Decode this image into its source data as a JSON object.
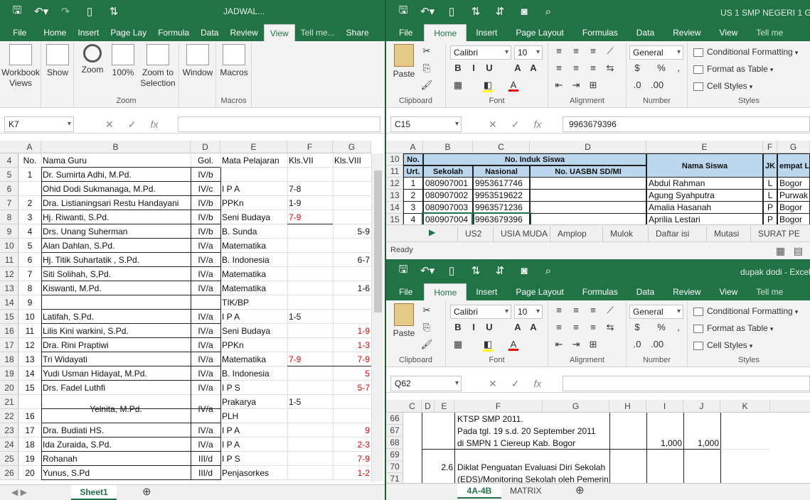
{
  "left": {
    "title": "JADWAL...",
    "tabs": [
      "File",
      "Home",
      "Insert",
      "Page Lay",
      "Formula",
      "Data",
      "Review",
      "View",
      "Tell me...",
      "Share"
    ],
    "active_tab": "View",
    "ribbon": {
      "workbook_views": "Workbook Views",
      "show": "Show",
      "zoom": "Zoom",
      "zoom100": "100%",
      "zoom_sel": "Zoom to Selection",
      "zoom_group": "Zoom",
      "window": "Window",
      "macros": "Macros",
      "macros_group": "Macros"
    },
    "namebox": "K7",
    "formula": "",
    "columns": [
      "A",
      "B",
      "D",
      "E",
      "F",
      "G"
    ],
    "rows": [
      {
        "r": "4",
        "a": "No.",
        "b": "Nama Guru",
        "d": "Gol.",
        "e": "Mata Pelajaran",
        "f": "Kls.VII",
        "g": "Kls.VIII"
      },
      {
        "r": "5",
        "a": "1",
        "b": "Dr. Sumirta Adhi, M.Pd.",
        "d": "IV/b",
        "e": "",
        "f": "",
        "g": ""
      },
      {
        "r": "6",
        "a": "",
        "b": "Ohid Dodi Sukmanaga, M.Pd.",
        "d": "IV/c",
        "e": "I P A",
        "f": "7-8",
        "g": ""
      },
      {
        "r": "7",
        "a": "2",
        "b": "Dra. Listianingsari Restu Handayani",
        "d": "IV/b",
        "e": "PPKn",
        "f": "1-9",
        "g": ""
      },
      {
        "r": "8",
        "a": "3",
        "b": "Hj. Riwanti, S.Pd.",
        "d": "IV/b",
        "e": "Seni Budaya",
        "f": "7-9",
        "g": ""
      },
      {
        "r": "9",
        "a": "4",
        "b": "Drs. Unang Suherman",
        "d": "IV/b",
        "e": "B. Sunda",
        "f": "",
        "g": "5-9"
      },
      {
        "r": "10",
        "a": "5",
        "b": "Alan Dahlan, S.Pd.",
        "d": "IV/a",
        "e": "Matematika",
        "f": "",
        "g": ""
      },
      {
        "r": "11",
        "a": "6",
        "b": "Hj. Titik Suhartatik , S.Pd.",
        "d": "IV/a",
        "e": "B. Indonesia",
        "f": "",
        "g": "6-7"
      },
      {
        "r": "12",
        "a": "7",
        "b": "Siti Solihah, S,Pd.",
        "d": "IV/a",
        "e": "Matematika",
        "f": "",
        "g": ""
      },
      {
        "r": "13",
        "a": "8",
        "b": "Kiswanti, M.Pd.",
        "d": "IV/a",
        "e": "Matematika",
        "f": "",
        "g": "1-6"
      },
      {
        "r": "14",
        "a": "9",
        "b": "",
        "d": "",
        "e": "TIK/BP",
        "f": "",
        "g": ""
      },
      {
        "r": "15",
        "a": "10",
        "b": "Latifah, S.Pd.",
        "d": "IV/a",
        "e": "I P A",
        "f": "1-5",
        "g": ""
      },
      {
        "r": "16",
        "a": "11",
        "b": "Lilis Kini warkini, S.Pd.",
        "d": "IV/a",
        "e": "Seni Budaya",
        "f": "",
        "g": "1-9"
      },
      {
        "r": "17",
        "a": "12",
        "b": "Dra. Rini Praptiwi",
        "d": "IV/a",
        "e": "PPKn",
        "f": "",
        "g": "1-3"
      },
      {
        "r": "18",
        "a": "13",
        "b": "Tri Widayati",
        "d": "IV/a",
        "e": "Matematika",
        "f": "7-9",
        "g": "7-9"
      },
      {
        "r": "19",
        "a": "14",
        "b": "Yudi Usman Hidayat, M.Pd.",
        "d": "IV/a",
        "e": "B. Indonesia",
        "f": "",
        "g": "5"
      },
      {
        "r": "20",
        "a": "15",
        "b": "Drs. Fadel Luthfi",
        "d": "IV/a",
        "e": "I P S",
        "f": "",
        "g": "5-7"
      },
      {
        "r": "21",
        "a": "",
        "b": "",
        "d": "",
        "e": "Prakarya",
        "f": "1-5",
        "g": ""
      },
      {
        "r": "22",
        "a": "16",
        "b": "Yelnita, M.Pd.",
        "d": "IV/a",
        "e": "PLH",
        "f": "",
        "g": ""
      },
      {
        "r": "23",
        "a": "17",
        "b": "Dra. Budiati HS.",
        "d": "IV/a",
        "e": "I P A",
        "f": "",
        "g": "9"
      },
      {
        "r": "24",
        "a": "18",
        "b": "Ida Zuraida, S.Pd.",
        "d": "IV/a",
        "e": "I P A",
        "f": "",
        "g": "2-3"
      },
      {
        "r": "25",
        "a": "19",
        "b": "Rohanah",
        "d": "III/d",
        "e": "I P S",
        "f": "",
        "g": "7-9"
      },
      {
        "r": "26",
        "a": "20",
        "b": "Yunus, S.Pd",
        "d": "III/d",
        "e": "Penjasorkes",
        "f": "",
        "g": "1-2"
      }
    ],
    "sheet_tab": "Sheet1"
  },
  "topright": {
    "title": "US 1 SMP NEGERI 1 GUN",
    "tabs": [
      "File",
      "Home",
      "Insert",
      "Page Layout",
      "Formulas",
      "Data",
      "Review",
      "View",
      "Tell me"
    ],
    "active_tab": "Home",
    "ribbon": {
      "paste": "Paste",
      "clipboard": "Clipboard",
      "font": "Calibri",
      "size": "10",
      "font_group": "Font",
      "alignment": "Alignment",
      "number_format": "General",
      "number": "Number",
      "cond": "Conditional Formatting",
      "fmt_table": "Format as Table",
      "cell_styles": "Cell Styles",
      "styles": "Styles"
    },
    "namebox": "C15",
    "formula": "9963679396",
    "columns": [
      "A",
      "B",
      "C",
      "D",
      "E",
      "F",
      "G"
    ],
    "header": {
      "no": "No.",
      "urt": "Urt.",
      "induk": "No. Induk Siswa",
      "sekolah": "Sekolah",
      "nasional": "Nasional",
      "uasbn": "No. UASBN SD/MI",
      "nama": "Nama Siswa",
      "jk": "JK",
      "tempat": "empat L"
    },
    "rows": [
      {
        "r": "12",
        "a": "1",
        "b": "080907001",
        "c": "9953617746",
        "e": "Abdul Rahman",
        "f": "L",
        "g": "Bogor"
      },
      {
        "r": "13",
        "a": "2",
        "b": "080907002",
        "c": "9953519622",
        "e": "Agung Syahputra",
        "f": "L",
        "g": "Purwak"
      },
      {
        "r": "14",
        "a": "3",
        "b": "080907003",
        "c": "9963571236",
        "e": "Amalia Hasanah",
        "f": "P",
        "g": "Bogor"
      },
      {
        "r": "15",
        "a": "4",
        "b": "080907004",
        "c": "9963679396",
        "e": "Aprilia Lestari",
        "f": "P",
        "g": "Bogor"
      }
    ],
    "row_headers": [
      "10",
      "11",
      "12",
      "13",
      "14",
      "15"
    ],
    "sheet_tabs": [
      "US2",
      "USIA MUDA",
      "Amplop",
      "Mulok",
      "Daftar isi",
      "Mutasi",
      "SURAT PE"
    ],
    "status": "Ready"
  },
  "bottomright": {
    "title": "dupak dodi - Excel",
    "tabs": [
      "File",
      "Home",
      "Insert",
      "Page Layout",
      "Formulas",
      "Data",
      "Review",
      "View",
      "Tell me"
    ],
    "active_tab": "Home",
    "namebox": "Q62",
    "formula": "",
    "columns": [
      "C",
      "D",
      "E",
      "F",
      "G",
      "H",
      "I",
      "J",
      "K"
    ],
    "row_headers": [
      "66",
      "67",
      "68",
      "69",
      "70",
      "71"
    ],
    "lines": [
      {
        "r": "66",
        "f": "KTSP SMP 2011.",
        "e": "",
        "i": "",
        "j": ""
      },
      {
        "r": "67",
        "f": "Pada tgl. 19 s.d. 20 September 2011",
        "e": "",
        "i": "",
        "j": ""
      },
      {
        "r": "68",
        "f": "di SMPN 1 Ciereup Kab. Bogor",
        "e": "",
        "i": "1,000",
        "j": "1,000"
      },
      {
        "r": "69",
        "f": "",
        "e": "",
        "i": "",
        "j": ""
      },
      {
        "r": "70",
        "f": "Diklat Penguatan Evaluasi Diri Sekolah",
        "e": "2.6",
        "i": "",
        "j": ""
      },
      {
        "r": "71",
        "f": "(EDS)/Monitoring Sekolah oleh Pemerintah",
        "e": "",
        "i": "",
        "j": ""
      }
    ],
    "sheet_tabs": [
      "4A-4B",
      "MATRIX"
    ]
  }
}
